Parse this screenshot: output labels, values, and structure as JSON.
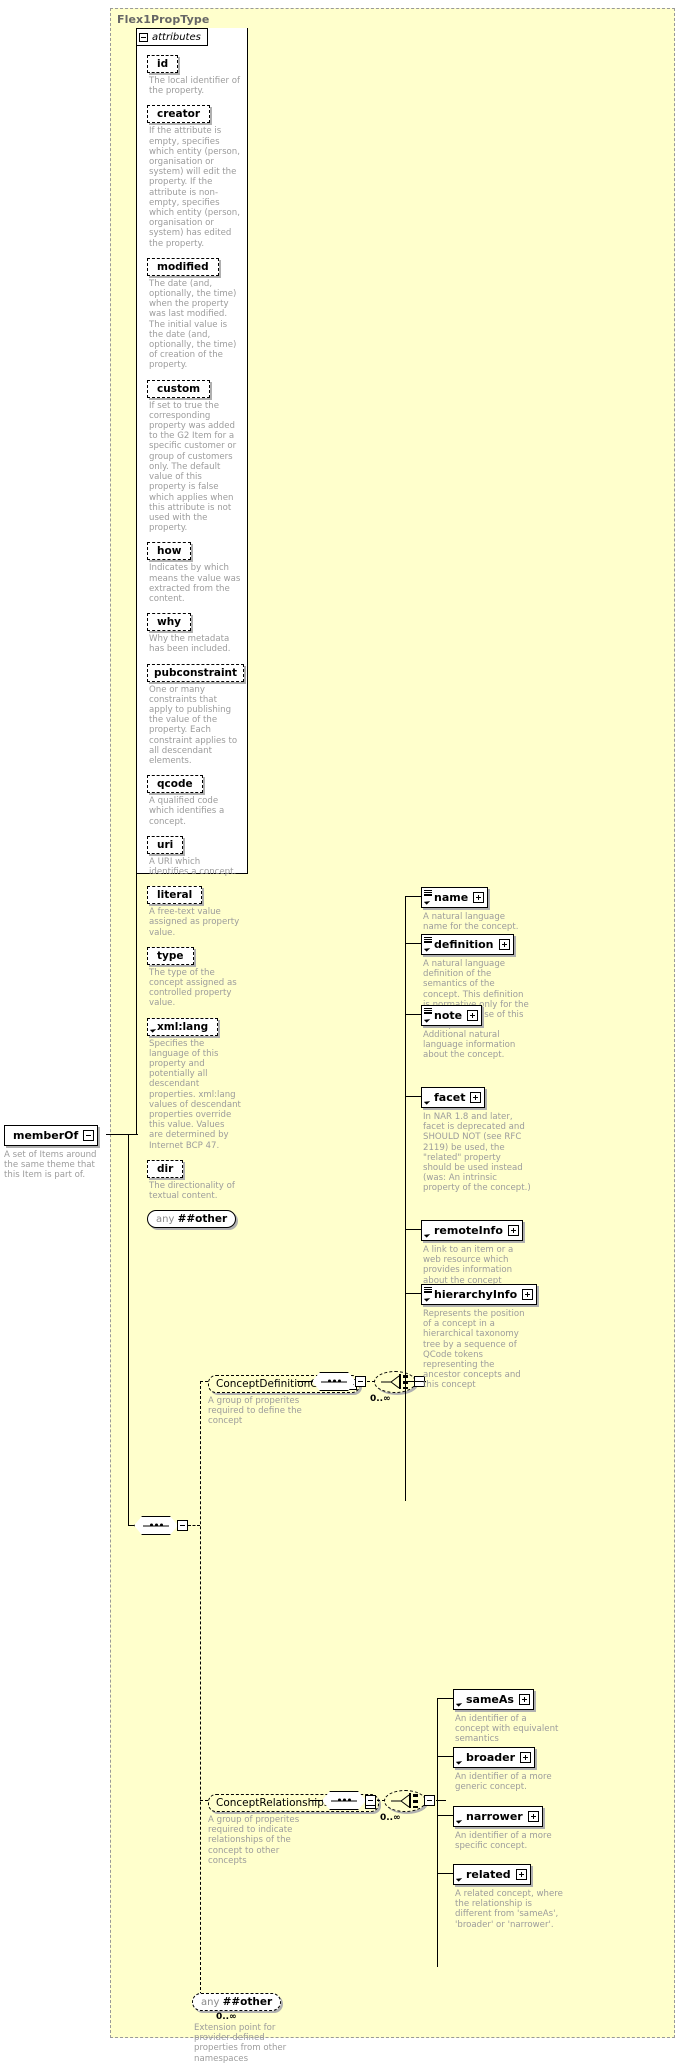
{
  "type_title": "Flex1PropType",
  "attributes_panel": {
    "label": "attributes",
    "toggle_icon": "collapse-minus-icon",
    "items": [
      {
        "name": "id",
        "doc": "The local identifier of the property."
      },
      {
        "name": "creator",
        "doc": "If the attribute is empty, specifies which entity (person, organisation or system) will edit the property. If the attribute is non-empty, specifies which entity (person, organisation or system) has edited the property."
      },
      {
        "name": "modified",
        "doc": "The date (and, optionally, the time) when the property was last modified. The initial value is the date (and, optionally, the time) of creation of the property."
      },
      {
        "name": "custom",
        "doc": "If set to true the corresponding property was added to the G2 Item for a specific customer or group of customers only. The default value of this property is false which applies when this attribute is not used with the property."
      },
      {
        "name": "how",
        "doc": "Indicates by which means the value was extracted from the content."
      },
      {
        "name": "why",
        "doc": "Why the metadata has been included."
      },
      {
        "name": "pubconstraint",
        "doc": "One or many constraints that apply to publishing the value of the property. Each constraint applies to all descendant elements."
      },
      {
        "name": "qcode",
        "doc": "A qualified code which identifies a concept."
      },
      {
        "name": "uri",
        "doc": "A URI which identifies a concept."
      },
      {
        "name": "literal",
        "doc": "A free-text value assigned as property value."
      },
      {
        "name": "type",
        "doc": "The type of the concept assigned as controlled property value."
      },
      {
        "name": "xml:lang",
        "doc": "Specifies the language of this property and potentially all descendant properties. xml:lang values of descendant properties override this value. Values are determined by Internet BCP 47."
      },
      {
        "name": "dir",
        "doc": "The directionality of textual content."
      }
    ],
    "any_attribute": {
      "prefix": "any",
      "namespace": "##other"
    }
  },
  "member_of": {
    "label": "memberOf",
    "doc": "A set of Items around the same theme that this Item is part of.",
    "toggle_icon": "collapse-minus-icon"
  },
  "root_sequence": {
    "icon": "sequence-compositor-icon",
    "toggle_icon": "collapse-minus-icon"
  },
  "groups": [
    {
      "label": "ConceptDefinitionGroup",
      "doc": "A group of properites required to define the concept",
      "toggle_icon": "collapse-minus-icon",
      "sequence_icon": "sequence-compositor-icon",
      "choice_icon": "choice-compositor-icon",
      "cardinality": "0..∞",
      "children": [
        {
          "name": "name",
          "doc": "A natural language name for the concept.",
          "has_seq_badge": true,
          "toggle_icon": "expand-plus-icon"
        },
        {
          "name": "definition",
          "doc": "A natural language definition of the semantics of the concept. This definition is normative only for the scope of the use of this concept.",
          "has_seq_badge": true,
          "toggle_icon": "expand-plus-icon"
        },
        {
          "name": "note",
          "doc": "Additional natural language information about the concept.",
          "has_seq_badge": true,
          "toggle_icon": "expand-plus-icon"
        },
        {
          "name": "facet",
          "doc": "In NAR 1.8 and later, facet is deprecated and SHOULD NOT (see RFC 2119) be used, the \"related\" property should be used instead (was: An intrinsic property of the concept.)",
          "has_seq_badge": false,
          "toggle_icon": "expand-plus-icon"
        },
        {
          "name": "remoteInfo",
          "doc": "A link to an item or a web resource which provides information about the concept",
          "has_seq_badge": false,
          "toggle_icon": "expand-plus-icon"
        },
        {
          "name": "hierarchyInfo",
          "doc": "Represents the position of a concept in a hierarchical taxonomy tree by a sequence of QCode tokens representing the ancestor concepts and this concept",
          "has_seq_badge": true,
          "toggle_icon": "expand-plus-icon"
        }
      ]
    },
    {
      "label": "ConceptRelationshipsGroup",
      "doc": "A group of properites required to indicate relationships of the concept to other concepts",
      "toggle_icon": "collapse-minus-icon",
      "sequence_icon": "sequence-compositor-icon",
      "choice_icon": "choice-compositor-icon",
      "cardinality": "0..∞",
      "children": [
        {
          "name": "sameAs",
          "doc": "An identifier of a concept with equivalent semantics",
          "has_seq_badge": false,
          "toggle_icon": "expand-plus-icon"
        },
        {
          "name": "broader",
          "doc": "An identifier of a more generic concept.",
          "has_seq_badge": false,
          "toggle_icon": "expand-plus-icon"
        },
        {
          "name": "narrower",
          "doc": "An identifier of a more specific concept.",
          "has_seq_badge": false,
          "toggle_icon": "expand-plus-icon"
        },
        {
          "name": "related",
          "doc": "A related concept, where the relationship is different from 'sameAs', 'broader' or 'narrower'.",
          "has_seq_badge": false,
          "toggle_icon": "expand-plus-icon"
        }
      ]
    }
  ],
  "any_element": {
    "prefix": "any",
    "namespace": "##other",
    "cardinality": "0..∞",
    "doc": "Extension point for provider-defined properties from other namespaces"
  },
  "colors": {
    "container_bg": "#ffffcc",
    "container_border": "#999999",
    "title_text": "#666666",
    "doc_text": "#9c9c9c",
    "box_shadow": "#b0b0b0",
    "line": "#000000"
  }
}
